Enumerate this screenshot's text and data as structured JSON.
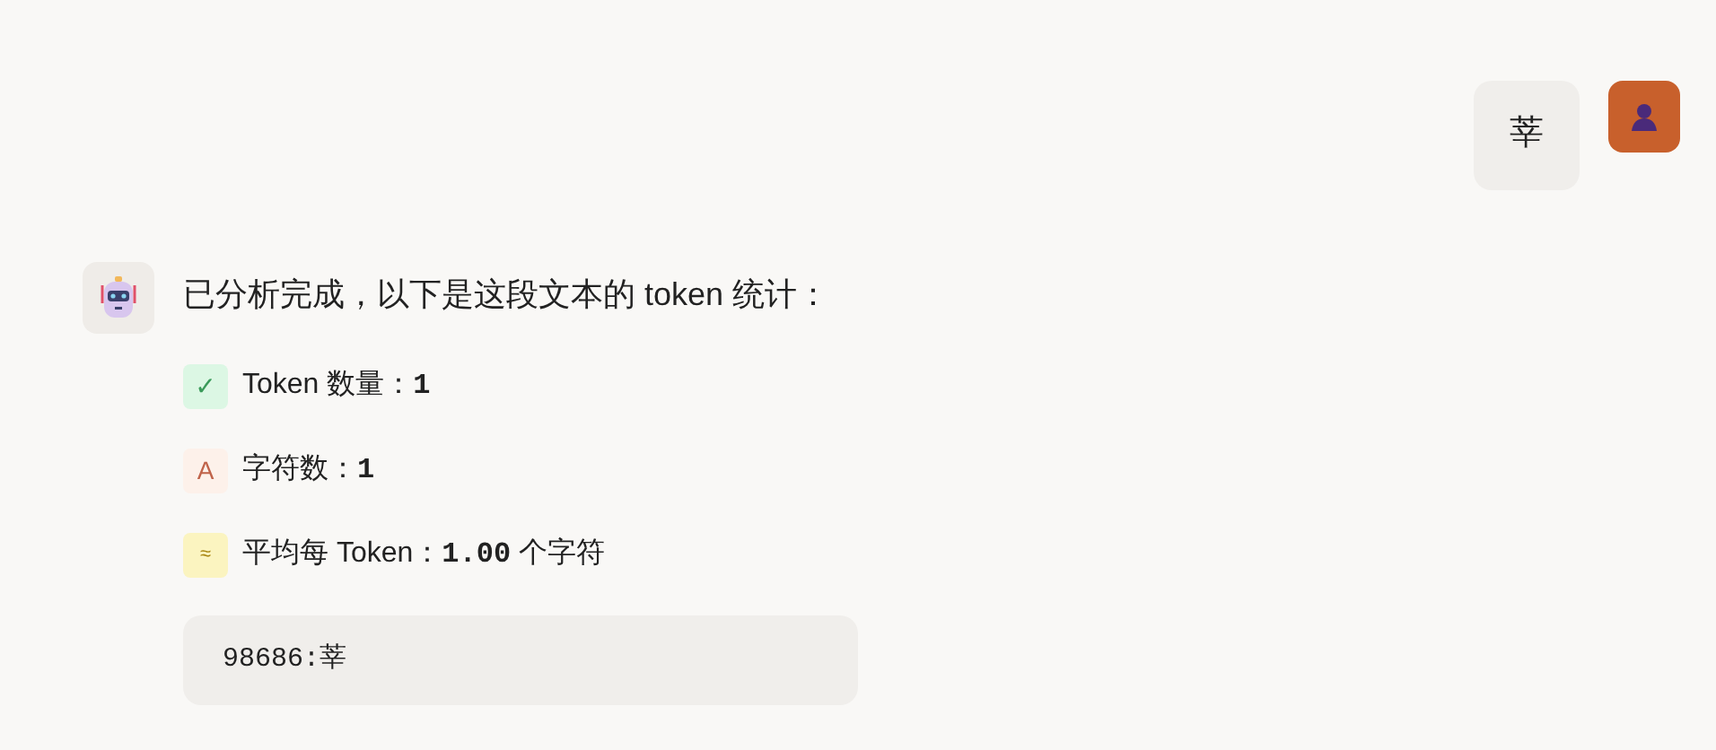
{
  "user_message": {
    "text": "莘"
  },
  "assistant_message": {
    "intro": "已分析完成，以下是这段文本的 token 统计：",
    "stats": [
      {
        "kind": "check",
        "icon": "✓",
        "label": "Token 数量：",
        "value": "1"
      },
      {
        "kind": "chars",
        "icon": "A",
        "label": "字符数：",
        "value": "1"
      },
      {
        "kind": "average",
        "icon": "≈",
        "label": "平均每 Token：",
        "value": "1.00",
        "suffix": " 个字符"
      }
    ],
    "code": "98686:莘"
  }
}
